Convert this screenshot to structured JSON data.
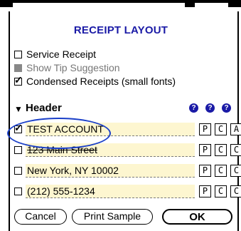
{
  "title": "RECEIPT LAYOUT",
  "options": [
    {
      "label": "Service Receipt",
      "checked": false,
      "disabled": false
    },
    {
      "label": "Show Tip Suggestion",
      "checked": false,
      "disabled": true
    },
    {
      "label": "Condensed Receipts (small fonts)",
      "checked": true,
      "disabled": false
    }
  ],
  "section": {
    "label": "Header",
    "help_icons": [
      "?",
      "?",
      "?"
    ]
  },
  "lines": [
    {
      "text": "TEST ACCOUNT",
      "checked": true,
      "buttons": [
        "P",
        "C",
        "A"
      ]
    },
    {
      "text": "123 Main Street",
      "checked": false,
      "buttons": [
        "P",
        "C",
        "C"
      ]
    },
    {
      "text": "New York, NY 10002",
      "checked": false,
      "buttons": [
        "P",
        "C",
        "C"
      ]
    },
    {
      "text": "(212) 555-1234",
      "checked": false,
      "buttons": [
        "P",
        "C",
        "C"
      ]
    }
  ],
  "buttons": {
    "cancel": "Cancel",
    "print_sample": "Print Sample",
    "ok": "OK"
  },
  "colors": {
    "accent": "#1a1aa6",
    "field_bg": "#fdf6d0",
    "highlight": "#1a3fc8"
  }
}
